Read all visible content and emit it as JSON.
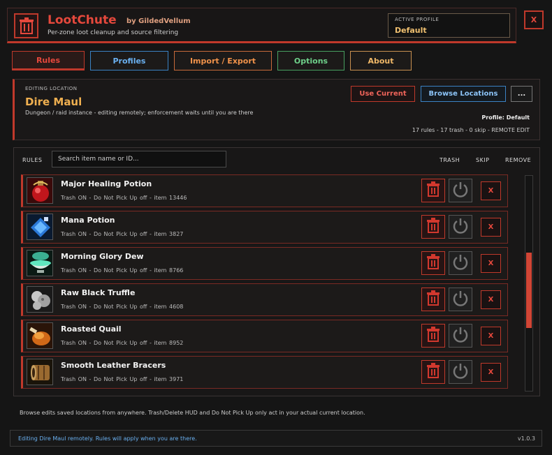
{
  "header": {
    "title": "LootChute",
    "author": "by GildedVellum",
    "tagline": "Per-zone loot cleanup and source filtering",
    "profile_label": "ACTIVE PROFILE",
    "profile_value": "Default",
    "close_label": "X"
  },
  "tabs": [
    {
      "label": "Rules",
      "active": true
    },
    {
      "label": "Profiles"
    },
    {
      "label": "Import / Export"
    },
    {
      "label": "Options"
    },
    {
      "label": "About"
    }
  ],
  "location": {
    "label": "EDITING LOCATION",
    "name": "Dire Maul",
    "description": "Dungeon / raid instance - editing remotely; enforcement waits until you are there",
    "use_current_label": "Use Current",
    "browse_label": "Browse Locations",
    "more_label": "...",
    "profile_line": "Profile: Default",
    "stats": "17 rules   -   17 trash   -   0 skip   -   REMOTE EDIT"
  },
  "rules": {
    "label": "RULES",
    "search_placeholder": "Search item name or ID...",
    "col_trash": "TRASH",
    "col_skip": "SKIP",
    "col_remove": "REMOVE",
    "remove_label": "X",
    "scroll_position": 0.55,
    "items": [
      {
        "name": "Major Healing Potion",
        "meta": "Trash ON  -  Do Not Pick Up off  -  item 13446",
        "icon": "healing-potion-icon"
      },
      {
        "name": "Mana Potion",
        "meta": "Trash ON  -  Do Not Pick Up off  -  item 3827",
        "icon": "mana-potion-icon"
      },
      {
        "name": "Morning Glory Dew",
        "meta": "Trash ON  -  Do Not Pick Up off  -  item 8766",
        "icon": "dew-bowl-icon"
      },
      {
        "name": "Raw Black Truffle",
        "meta": "Trash ON  -  Do Not Pick Up off  -  item 4608",
        "icon": "truffle-icon"
      },
      {
        "name": "Roasted Quail",
        "meta": "Trash ON  -  Do Not Pick Up off  -  item 8952",
        "icon": "roasted-quail-icon"
      },
      {
        "name": "Smooth Leather Bracers",
        "meta": "Trash ON  -  Do Not Pick Up off  -  item 3971",
        "icon": "bracers-icon"
      }
    ]
  },
  "footer_note": "Browse edits saved locations from anywhere. Trash/Delete HUD and Do Not Pick Up only act in your actual current location.",
  "status": {
    "text": "Editing Dire Maul remotely. Rules will apply when you are there.",
    "version": "v1.0.3"
  }
}
